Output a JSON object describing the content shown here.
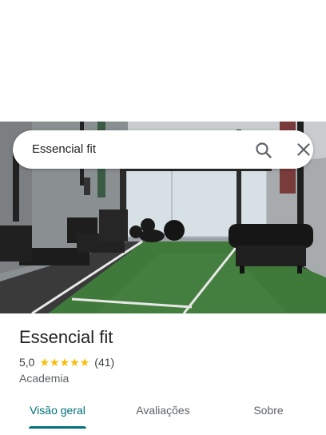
{
  "search": {
    "query": "Essencial fit"
  },
  "place": {
    "name": "Essencial fit",
    "rating": "5,0",
    "stars": 5,
    "review_count": "(41)",
    "category": "Academia"
  },
  "tabs": [
    {
      "label": "Visão geral",
      "active": true
    },
    {
      "label": "Avaliações",
      "active": false
    },
    {
      "label": "Sobre",
      "active": false
    }
  ],
  "icons": {
    "search": "search-icon",
    "close": "close-icon",
    "star": "star-icon"
  },
  "colors": {
    "accent": "#00707a",
    "star": "#fbbc04",
    "text": "#202124",
    "secondary_text": "#5f6368"
  }
}
